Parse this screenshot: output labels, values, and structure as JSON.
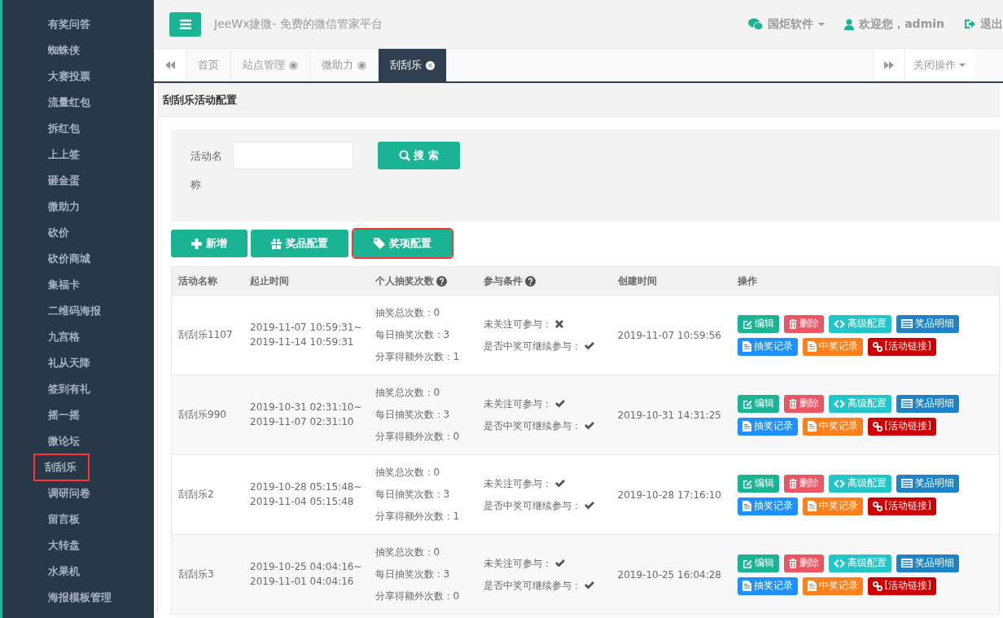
{
  "sidebar": {
    "items": [
      {
        "label": "有奖问答",
        "highlighted": false
      },
      {
        "label": "蜘蛛侠",
        "highlighted": false
      },
      {
        "label": "大赛投票",
        "highlighted": false
      },
      {
        "label": "流量红包",
        "highlighted": false
      },
      {
        "label": "拆红包",
        "highlighted": false
      },
      {
        "label": "上上签",
        "highlighted": false
      },
      {
        "label": "砸金蛋",
        "highlighted": false
      },
      {
        "label": "微助力",
        "highlighted": false
      },
      {
        "label": "砍价",
        "highlighted": false
      },
      {
        "label": "砍价商城",
        "highlighted": false
      },
      {
        "label": "集福卡",
        "highlighted": false
      },
      {
        "label": "二维码海报",
        "highlighted": false
      },
      {
        "label": "九宫格",
        "highlighted": false
      },
      {
        "label": "礼从天降",
        "highlighted": false
      },
      {
        "label": "签到有礼",
        "highlighted": false
      },
      {
        "label": "摇一摇",
        "highlighted": false
      },
      {
        "label": "微论坛",
        "highlighted": false
      },
      {
        "label": "刮刮乐",
        "highlighted": true
      },
      {
        "label": "调研问卷",
        "highlighted": false
      },
      {
        "label": "留言板",
        "highlighted": false
      },
      {
        "label": "大转盘",
        "highlighted": false
      },
      {
        "label": "水果机",
        "highlighted": false
      },
      {
        "label": "海报模板管理",
        "highlighted": false
      }
    ]
  },
  "header": {
    "title": "JeeWx捷微- 免费的微信管家平台",
    "org": "国炬软件",
    "welcome": "欢迎您，admin",
    "logout": "退出"
  },
  "tabs": [
    {
      "label": "首页",
      "closable": false,
      "selected": false
    },
    {
      "label": "站点管理",
      "closable": true,
      "selected": false
    },
    {
      "label": "微助力",
      "closable": true,
      "selected": false
    },
    {
      "label": "刮刮乐",
      "closable": true,
      "selected": true
    }
  ],
  "close_menu": "关闭操作",
  "panel": {
    "title": "刮刮乐活动配置",
    "search": {
      "label": "活动名称",
      "button": "搜 索"
    },
    "toolbar": [
      {
        "label": "新增",
        "kind": "add",
        "highlighted": false
      },
      {
        "label": "奖品配置",
        "kind": "gift",
        "highlighted": false
      },
      {
        "label": "奖项配置",
        "kind": "tag",
        "highlighted": true
      }
    ],
    "table": {
      "columns": [
        {
          "label": "活动名称",
          "help": false
        },
        {
          "label": "起止时间",
          "help": false
        },
        {
          "label": "个人抽奖次数",
          "help": true
        },
        {
          "label": "参与条件",
          "help": true
        },
        {
          "label": "创建时间",
          "help": false
        },
        {
          "label": "操作",
          "help": false
        }
      ],
      "rows": [
        {
          "name": "刮刮乐1107",
          "period": [
            "2019-11-07 10:59:31~",
            "2019-11-14 10:59:31"
          ],
          "counts": [
            "抽奖总次数：0",
            "每日抽奖次数：3",
            "分享得额外次数：1"
          ],
          "conditions": [
            {
              "label": "未关注可参与：",
              "checked": false
            },
            {
              "label": "是否中奖可继续参与：",
              "checked": true
            }
          ],
          "created": "2019-11-07 10:59:56",
          "actions": [
            {
              "label": "编辑",
              "kind": "edit"
            },
            {
              "label": "删除",
              "kind": "delete"
            },
            {
              "label": "高级配置",
              "kind": "advanced"
            },
            {
              "label": "奖品明细",
              "kind": "detail"
            },
            {
              "label": "抽奖记录",
              "kind": "draws"
            },
            {
              "label": "中奖记录",
              "kind": "wins"
            },
            {
              "label": "[活动链接]",
              "kind": "link"
            }
          ]
        },
        {
          "name": "刮刮乐990",
          "period": [
            "2019-10-31 02:31:10~",
            "2019-11-07 02:31:10"
          ],
          "counts": [
            "抽奖总次数：0",
            "每日抽奖次数：3",
            "分享得额外次数：0"
          ],
          "conditions": [
            {
              "label": "未关注可参与：",
              "checked": true
            },
            {
              "label": "是否中奖可继续参与：",
              "checked": true
            }
          ],
          "created": "2019-10-31 14:31:25",
          "actions": [
            {
              "label": "编辑",
              "kind": "edit"
            },
            {
              "label": "删除",
              "kind": "delete"
            },
            {
              "label": "高级配置",
              "kind": "advanced"
            },
            {
              "label": "奖品明细",
              "kind": "detail"
            },
            {
              "label": "抽奖记录",
              "kind": "draws"
            },
            {
              "label": "中奖记录",
              "kind": "wins"
            },
            {
              "label": "[活动链接]",
              "kind": "link"
            }
          ]
        },
        {
          "name": "刮刮乐2",
          "period": [
            "2019-10-28 05:15:48~",
            "2019-11-04 05:15:48"
          ],
          "counts": [
            "抽奖总次数：0",
            "每日抽奖次数：3",
            "分享得额外次数：1"
          ],
          "conditions": [
            {
              "label": "未关注可参与：",
              "checked": true
            },
            {
              "label": "是否中奖可继续参与：",
              "checked": true
            }
          ],
          "created": "2019-10-28 17:16:10",
          "actions": [
            {
              "label": "编辑",
              "kind": "edit"
            },
            {
              "label": "删除",
              "kind": "delete"
            },
            {
              "label": "高级配置",
              "kind": "advanced"
            },
            {
              "label": "奖品明细",
              "kind": "detail"
            },
            {
              "label": "抽奖记录",
              "kind": "draws"
            },
            {
              "label": "中奖记录",
              "kind": "wins"
            },
            {
              "label": "[活动链接]",
              "kind": "link"
            }
          ]
        },
        {
          "name": "刮刮乐3",
          "period": [
            "2019-10-25 04:04:16~",
            "2019-11-01 04:04:16"
          ],
          "counts": [
            "抽奖总次数：0",
            "每日抽奖次数：3",
            "分享得额外次数：0"
          ],
          "conditions": [
            {
              "label": "未关注可参与：",
              "checked": true
            },
            {
              "label": "是否中奖可继续参与：",
              "checked": true
            }
          ],
          "created": "2019-10-25 16:04:28",
          "actions": [
            {
              "label": "编辑",
              "kind": "edit"
            },
            {
              "label": "删除",
              "kind": "delete"
            },
            {
              "label": "高级配置",
              "kind": "advanced"
            },
            {
              "label": "奖品明细",
              "kind": "detail"
            },
            {
              "label": "抽奖记录",
              "kind": "draws"
            },
            {
              "label": "中奖记录",
              "kind": "wins"
            },
            {
              "label": "[活动链接]",
              "kind": "link"
            }
          ]
        }
      ]
    }
  }
}
